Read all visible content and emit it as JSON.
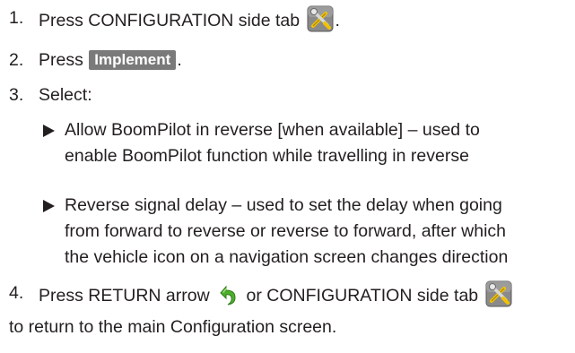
{
  "steps": [
    {
      "number": "1.",
      "text_before": "Press CONFIGURATION side tab",
      "icon": "configuration-tools-icon",
      "text_after": "."
    },
    {
      "number": "2.",
      "text_before": "Press",
      "button_label": "Implement",
      "text_after": "."
    },
    {
      "number": "3.",
      "text": "Select:"
    },
    {
      "number": "4.",
      "text_before": "Press RETURN arrow",
      "icon1": "return-arrow-icon",
      "text_middle": "or CONFIGURATION side tab",
      "icon2": "configuration-tools-icon",
      "line2": "to return to the main Configuration screen."
    }
  ],
  "bullets": [
    {
      "lines": [
        "Allow BoomPilot in reverse [when available] – used to",
        "enable BoomPilot function while travelling in reverse"
      ]
    },
    {
      "lines": [
        "Reverse signal delay – used to set the delay when going",
        "from forward to reverse or reverse to forward, after which",
        "the vehicle icon on a navigation screen changes direction"
      ]
    }
  ],
  "colors": {
    "text": "#231f20",
    "button_bg": "#7a7a7a",
    "button_text": "#ffffff",
    "return_arrow": "#4caf2c",
    "tool_bg": "#8a8a8a",
    "tool_yellow": "#f2c200"
  }
}
